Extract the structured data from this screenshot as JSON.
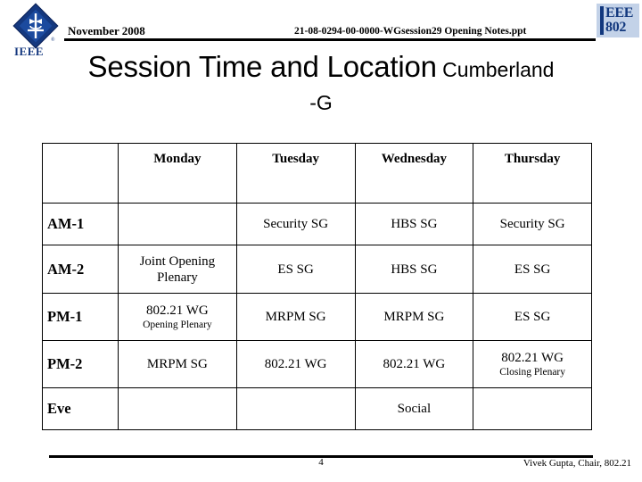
{
  "header": {
    "date": "November 2008",
    "doc_id": "21-08-0294-00-0000-WGsession29  Opening  Notes.ppt",
    "ieee_logo_label": "IEEE",
    "ieee802_line1": "EEE",
    "ieee802_line2": "802",
    "logo_color": "#14387f",
    "logo_bg": "#c3d2e8"
  },
  "title": {
    "main": "Session Time and Location",
    "sub": " Cumberland",
    "line2": "-G"
  },
  "table": {
    "columns": [
      "",
      "Monday",
      "Tuesday",
      "Wednesday",
      "Thursday"
    ],
    "rows": [
      {
        "label": "AM-1",
        "cells": [
          {
            "main": "",
            "sub": ""
          },
          {
            "main": "Security SG",
            "sub": ""
          },
          {
            "main": "HBS SG",
            "sub": ""
          },
          {
            "main": "Security SG",
            "sub": ""
          }
        ]
      },
      {
        "label": "AM-2",
        "cells": [
          {
            "main": "Joint Opening Plenary",
            "sub": ""
          },
          {
            "main": "ES SG",
            "sub": ""
          },
          {
            "main": "HBS SG",
            "sub": ""
          },
          {
            "main": "ES SG",
            "sub": ""
          }
        ]
      },
      {
        "label": "PM-1",
        "cells": [
          {
            "main": "802.21 WG",
            "sub": "Opening Plenary"
          },
          {
            "main": "MRPM SG",
            "sub": ""
          },
          {
            "main": "MRPM SG",
            "sub": ""
          },
          {
            "main": "ES SG",
            "sub": ""
          }
        ]
      },
      {
        "label": "PM-2",
        "cells": [
          {
            "main": "MRPM SG",
            "sub": ""
          },
          {
            "main": "802.21 WG",
            "sub": ""
          },
          {
            "main": "802.21 WG",
            "sub": ""
          },
          {
            "main": "802.21 WG",
            "sub": "Closing Plenary"
          }
        ]
      },
      {
        "label": "Eve",
        "cells": [
          {
            "main": "",
            "sub": ""
          },
          {
            "main": "",
            "sub": ""
          },
          {
            "main": "Social",
            "sub": ""
          },
          {
            "main": "",
            "sub": ""
          }
        ]
      }
    ]
  },
  "footer": {
    "page_number": "4",
    "credit": "Vivek Gupta, Chair, 802.21"
  }
}
